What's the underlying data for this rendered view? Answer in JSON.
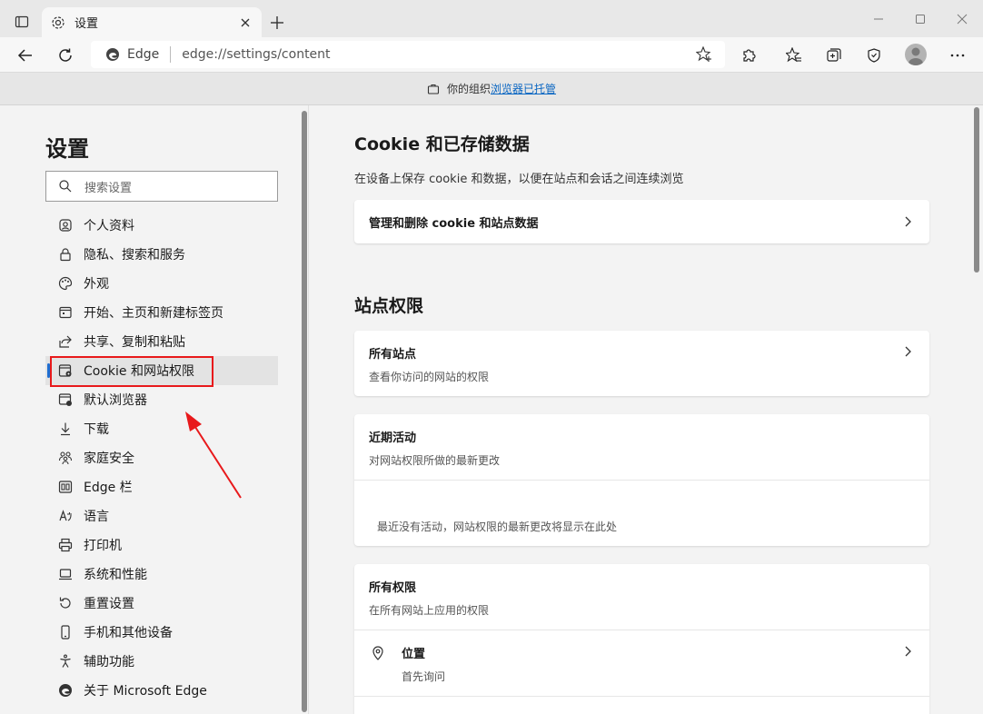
{
  "browser": {
    "tab_title": "设置",
    "site_label": "Edge",
    "url": "edge://settings/content"
  },
  "banner": {
    "text": "你的组织",
    "link": "浏览器已托管"
  },
  "sidebar": {
    "title": "设置",
    "search_placeholder": "搜索设置",
    "items": [
      {
        "label": "个人资料",
        "icon": "profile-icon"
      },
      {
        "label": "隐私、搜索和服务",
        "icon": "lock-icon"
      },
      {
        "label": "外观",
        "icon": "palette-icon"
      },
      {
        "label": "开始、主页和新建标签页",
        "icon": "home-icon"
      },
      {
        "label": "共享、复制和粘贴",
        "icon": "share-icon"
      },
      {
        "label": "Cookie 和网站权限",
        "icon": "cookie-settings-icon",
        "active": true
      },
      {
        "label": "默认浏览器",
        "icon": "browser-icon"
      },
      {
        "label": "下载",
        "icon": "download-icon"
      },
      {
        "label": "家庭安全",
        "icon": "family-icon"
      },
      {
        "label": "Edge 栏",
        "icon": "edge-bar-icon"
      },
      {
        "label": "语言",
        "icon": "language-icon"
      },
      {
        "label": "打印机",
        "icon": "printer-icon"
      },
      {
        "label": "系统和性能",
        "icon": "laptop-icon"
      },
      {
        "label": "重置设置",
        "icon": "reset-icon"
      },
      {
        "label": "手机和其他设备",
        "icon": "phone-icon"
      },
      {
        "label": "辅助功能",
        "icon": "accessibility-icon"
      },
      {
        "label": "关于 Microsoft Edge",
        "icon": "edge-logo-icon"
      }
    ]
  },
  "main": {
    "cookie_section_title": "Cookie 和已存储数据",
    "cookie_section_desc": "在设备上保存 cookie 和数据，以便在站点和会话之间连续浏览",
    "manage_cookies": "管理和删除 cookie 和站点数据",
    "site_perm_title": "站点权限",
    "all_sites_title": "所有站点",
    "all_sites_sub": "查看你访问的网站的权限",
    "recent_title": "近期活动",
    "recent_sub": "对网站权限所做的最新更改",
    "recent_empty": "最近没有活动，网站权限的最新更改将显示在此处",
    "all_perm_title": "所有权限",
    "all_perm_sub": "在所有网站上应用的权限",
    "location_title": "位置",
    "location_sub": "首先询问"
  },
  "colors": {
    "highlight": "#e8191b",
    "link": "#0a66c2",
    "active_indicator": "#1f6fd1"
  }
}
